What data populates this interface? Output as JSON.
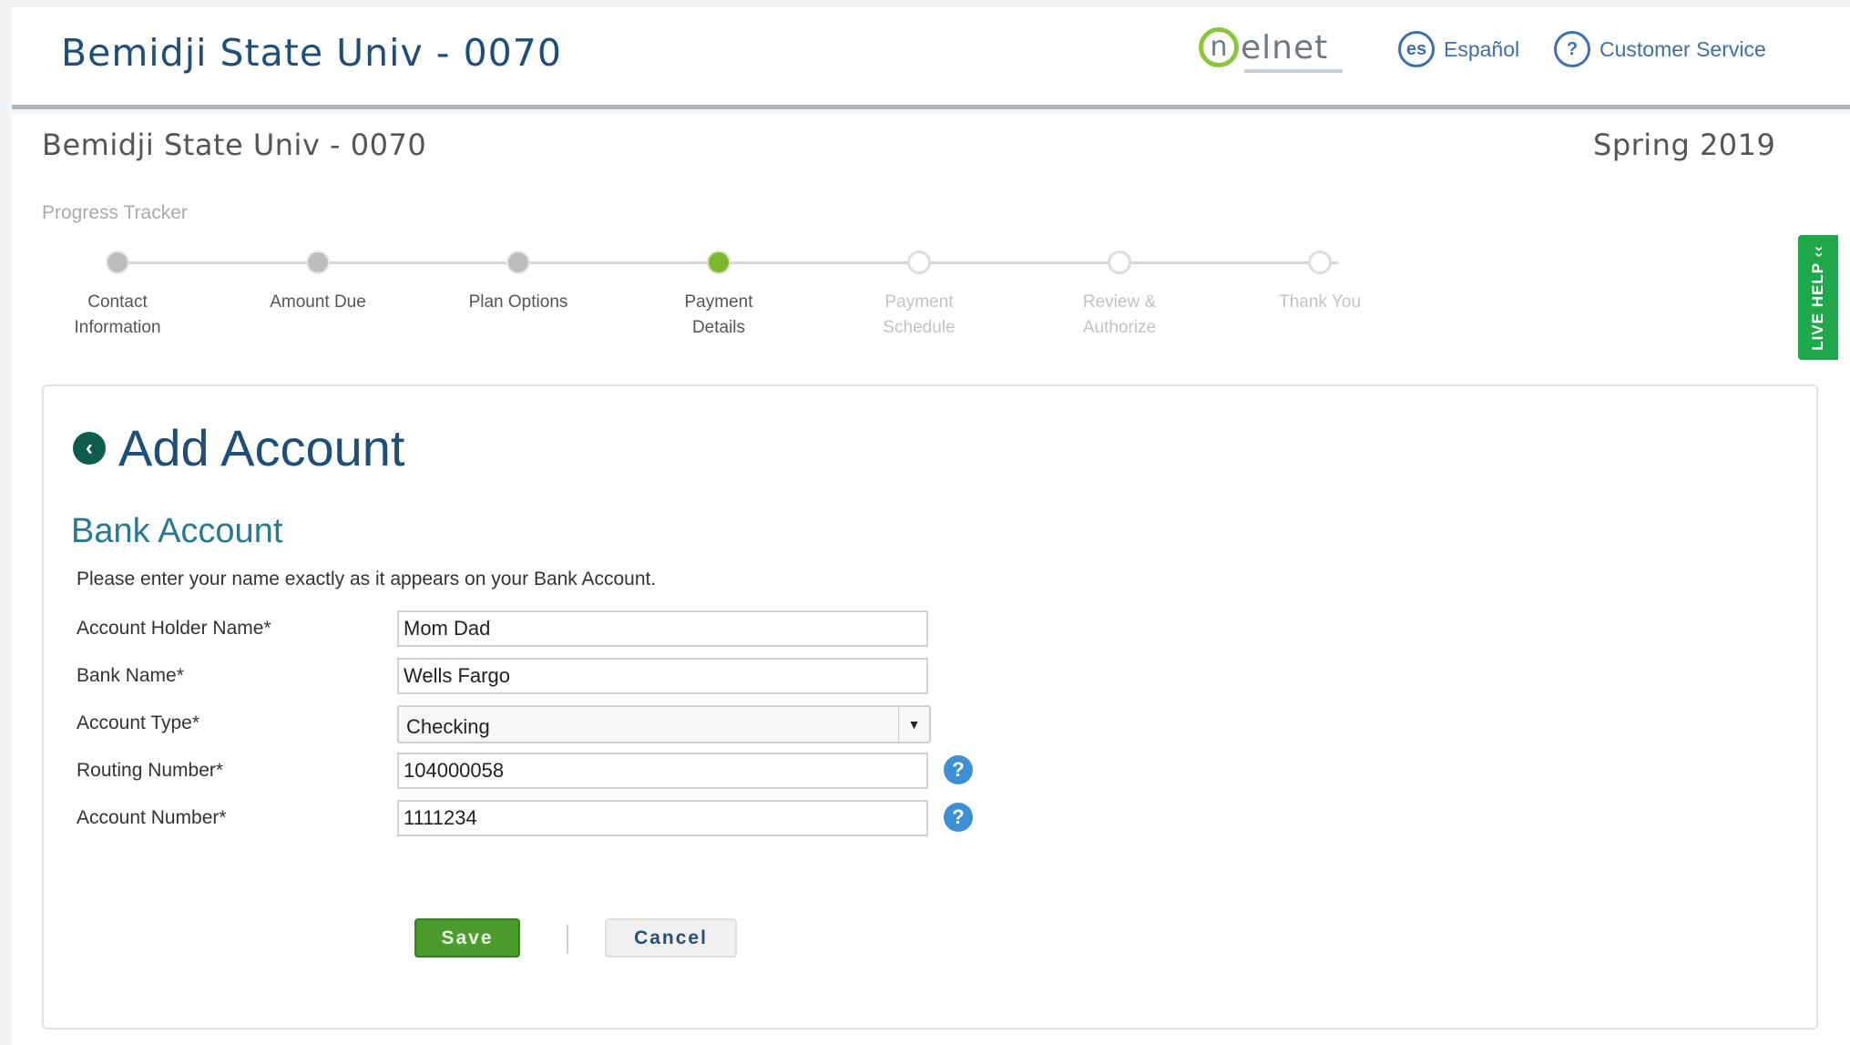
{
  "header": {
    "title": "Bemidji State Univ - 0070",
    "logo_initial": "n",
    "logo_text": "elnet",
    "espanol_icon": "es",
    "espanol_label": "Español",
    "help_icon": "?",
    "customer_service_label": "Customer Service"
  },
  "main": {
    "institution": "Bemidji State Univ - 0070",
    "term": "Spring 2019",
    "live_help": "LIVE HELP ‹‹",
    "tracker_label": "Progress Tracker",
    "steps": [
      {
        "label": "Contact\nInformation",
        "state": "done"
      },
      {
        "label": "Amount Due",
        "state": "done"
      },
      {
        "label": "Plan Options",
        "state": "done"
      },
      {
        "label": "Payment\nDetails",
        "state": "active"
      },
      {
        "label": "Payment\nSchedule",
        "state": "future"
      },
      {
        "label": "Review &\nAuthorize",
        "state": "future"
      },
      {
        "label": "Thank You",
        "state": "future"
      }
    ]
  },
  "card": {
    "back_icon": "‹",
    "title": "Add Account",
    "section_title": "Bank Account",
    "instructions": "Please enter your name exactly as it appears on your Bank Account.",
    "fields": {
      "holder_label": "Account Holder Name*",
      "holder_value": "Mom Dad",
      "bank_label": "Bank Name*",
      "bank_value": "Wells Fargo",
      "type_label": "Account Type*",
      "type_value": "Checking",
      "routing_label": "Routing Number*",
      "routing_value": "104000058",
      "account_label": "Account Number*",
      "account_value": "1111234",
      "help_glyph": "?"
    },
    "save_label": "Save",
    "cancel_label": "Cancel"
  },
  "colors": {
    "brand_blue": "#1f4e79",
    "accent_green": "#7cb82f",
    "live_help_green": "#1fa84a",
    "link_blue": "#3d6fa8"
  }
}
